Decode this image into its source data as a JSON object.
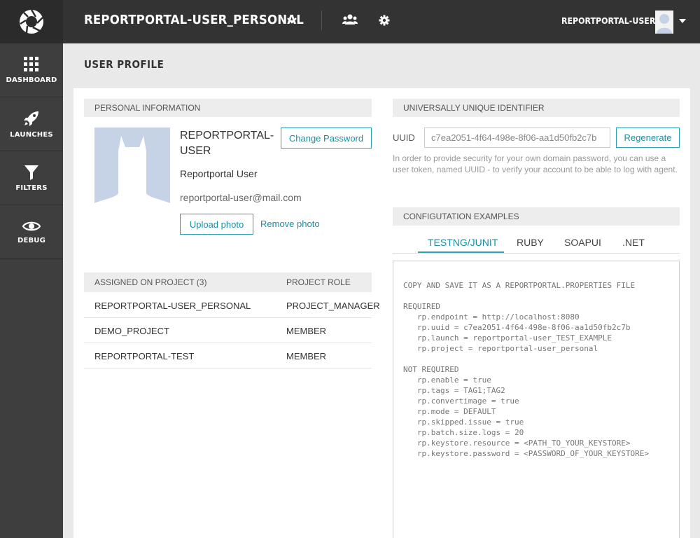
{
  "sidebar": {
    "items": [
      {
        "label": "DASHBOARD",
        "icon": "grid-icon"
      },
      {
        "label": "LAUNCHES",
        "icon": "rocket-icon"
      },
      {
        "label": "FILTERS",
        "icon": "filter-icon"
      },
      {
        "label": "DEBUG",
        "icon": "eye-icon"
      }
    ]
  },
  "header": {
    "project": "REPORTPORTAL-USER_PERSONAL",
    "user": "REPORTPORTAL-USER"
  },
  "page_title": "USER PROFILE",
  "personal": {
    "heading": "PERSONAL INFORMATION",
    "login": "REPORTPORTAL-USER",
    "full_name": "Reportportal User",
    "email": "reportportal-user@mail.com",
    "change_password": "Change Password",
    "upload_photo": "Upload photo",
    "remove_photo": "Remove photo"
  },
  "projects": {
    "col_project": "ASSIGNED ON PROJECT (3)",
    "col_role": "PROJECT ROLE",
    "rows": [
      {
        "name": "REPORTPORTAL-USER_PERSONAL",
        "role": "PROJECT_MANAGER"
      },
      {
        "name": "DEMO_PROJECT",
        "role": "MEMBER"
      },
      {
        "name": "REPORTPORTAL-TEST",
        "role": "MEMBER"
      }
    ]
  },
  "uuid": {
    "heading": "UNIVERSALLY UNIQUE IDENTIFIER",
    "label": "UUID",
    "value": "c7ea2051-4f64-498e-8f06-aa1d50fb2c7b",
    "regenerate": "Regenerate",
    "note": "In order to provide security for your own domain password, you can use a user token, named UUID - to verify your account to be able to log with agent."
  },
  "config": {
    "heading": "CONFIGUTATION EXAMPLES",
    "tabs": [
      "TESTNG/JUNIT",
      "RUBY",
      "SOAPUI",
      ".NET"
    ],
    "active_tab": "TESTNG/JUNIT",
    "code": "COPY AND SAVE IT AS A REPORTPORTAL.PROPERTIES FILE\n\nREQUIRED\n   rp.endpoint = http://localhost:8080\n   rp.uuid = c7ea2051-4f64-498e-8f06-aa1d50fb2c7b\n   rp.launch = reportportal-user_TEST_EXAMPLE\n   rp.project = reportportal-user_personal\n\nNOT REQUIRED\n   rp.enable = true\n   rp.tags = TAG1;TAG2\n   rp.convertimage = true\n   rp.mode = DEFAULT\n   rp.skipped.issue = true\n   rp.batch.size.logs = 20\n   rp.keystore.resource = <PATH_TO_YOUR_KEYSTORE>\n   rp.keystore.password = <PASSWORD_OF_YOUR_KEYSTORE>"
  },
  "colors": {
    "accent": "#2aa0b0",
    "sidebar_bg": "#3e3e3e",
    "header_bg": "#333333"
  }
}
